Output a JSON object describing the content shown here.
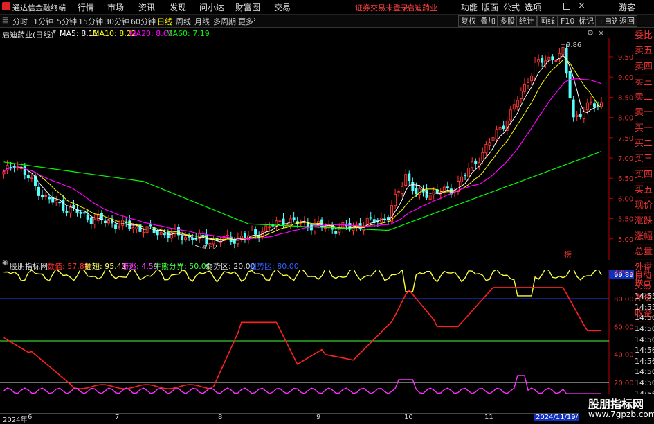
{
  "app": {
    "title": "通达信金融终端",
    "status_notice": "证券交易未登录",
    "stock_short": "启迪药业"
  },
  "menu": [
    "行情",
    "市场",
    "资讯",
    "发现",
    "问小达",
    "财富圈",
    "交易"
  ],
  "menu_right": [
    "功能",
    "版面",
    "公式",
    "选项",
    "游客"
  ],
  "timeframes": [
    "分时",
    "1分钟",
    "5分钟",
    "15分钟",
    "30分钟",
    "60分钟",
    "日线",
    "周线",
    "月线",
    "多周期",
    "更多"
  ],
  "active_timeframe": "日线",
  "right_buttons": [
    "复权",
    "叠加",
    "多股",
    "统计",
    "画线",
    "F10",
    "标记",
    "+自选",
    "返回"
  ],
  "main_legend": {
    "name": "启迪药业(日线)",
    "ma5": "MA5: 8.11",
    "ma10": "MA10: 8.22",
    "ma20": "MA20: 8.62",
    "ma60": "MA60: 7.19"
  },
  "price_axis": [
    "9.50",
    "9.00",
    "8.50",
    "8.00",
    "7.50",
    "7.00",
    "6.50",
    "6.00",
    "5.50",
    "5.00"
  ],
  "annotations": {
    "high": "9.86",
    "low": "4.82",
    "tag": "榜"
  },
  "indicator_legend": {
    "name": "股朋指标网",
    "value": "数值: 57.88",
    "ins": "插翅: 95.41",
    "run": "滞逃: 4.59",
    "bull": "牛熊分界: 50.00",
    "weak": "弱势区: 20.00",
    "strong": "强势区: 80.00"
  },
  "indicator_axis": [
    "99.89",
    "100.0",
    "80.00",
    "60.00",
    "40.00",
    "20.00"
  ],
  "side_panel": [
    "委比",
    "卖五",
    "卖四",
    "卖三",
    "卖二",
    "卖一",
    "买一",
    "买二",
    "买三",
    "买四",
    "买五",
    "现价",
    "涨跌",
    "涨幅",
    "总量",
    "外盘",
    "换手",
    "净资",
    "收益"
  ],
  "side_panel2": [
    "自动",
    "交易",
    "14:55",
    "14:55",
    "14:56",
    "14:56",
    "14:56",
    "14:56",
    "14:56",
    "14:56",
    "14:56",
    "14:56",
    "14:56"
  ],
  "date_axis": [
    "2024年",
    "6",
    "7",
    "8",
    "9",
    "10",
    "11",
    "2024/11/19/"
  ],
  "watermark": {
    "line1": "股朋指标网",
    "line2": "www.7gpzb.com"
  },
  "colors": {
    "up": "#ff3232",
    "down": "#54ffff",
    "ma5": "#ffffff",
    "ma10": "#ffff00",
    "ma20": "#ff00ff",
    "ma60": "#00ff00",
    "bg": "#000000"
  }
}
